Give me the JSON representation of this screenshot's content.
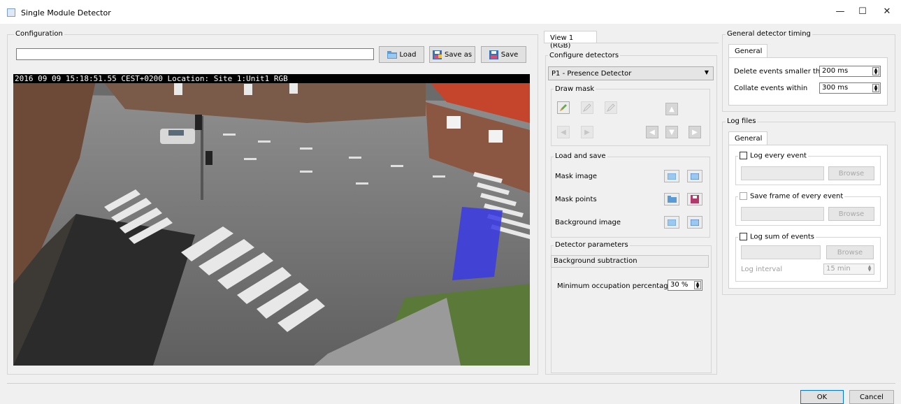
{
  "window": {
    "title": "Single Module Detector",
    "minimize": "—",
    "maximize": "☐",
    "close": "✕"
  },
  "configuration": {
    "label": "Configuration",
    "path_value": "",
    "load": "Load",
    "save_as": "Save as",
    "save": "Save"
  },
  "video": {
    "overlay": "2016 09 09 15:18:51.55 CEST+0200 Location: Site 1:Unit1 RGB"
  },
  "view": {
    "tab_label": "View 1 (RGB)",
    "configure_detectors": "Configure detectors",
    "detector_select": "P1 - Presence Detector",
    "draw_mask": "Draw mask",
    "load_and_save": "Load and save",
    "mask_image": "Mask image",
    "mask_points": "Mask points",
    "background_image": "Background image",
    "detector_parameters": "Detector parameters",
    "background_subtraction": "Background subtraction",
    "min_occupation_label": "Minimum occupation percentage",
    "min_occupation_value": "30 %"
  },
  "timing": {
    "title": "General detector timing",
    "tab_label": "General",
    "delete_label": "Delete events smaller than",
    "delete_value": "200 ms",
    "collate_label": "Collate events within",
    "collate_value": "300 ms"
  },
  "logs": {
    "title": "Log files",
    "tab_label": "General",
    "log_every_event": "Log every event",
    "save_frame": "Save frame of every event",
    "log_sum": "Log sum of events",
    "browse": "Browse",
    "log_interval_label": "Log interval",
    "log_interval_value": "15 min"
  },
  "footer": {
    "ok": "OK",
    "cancel": "Cancel"
  },
  "colors": {
    "mask_blue": "#3a3ae6",
    "roof_red": "#c4442c",
    "window_bg": "#f0f0f0"
  }
}
